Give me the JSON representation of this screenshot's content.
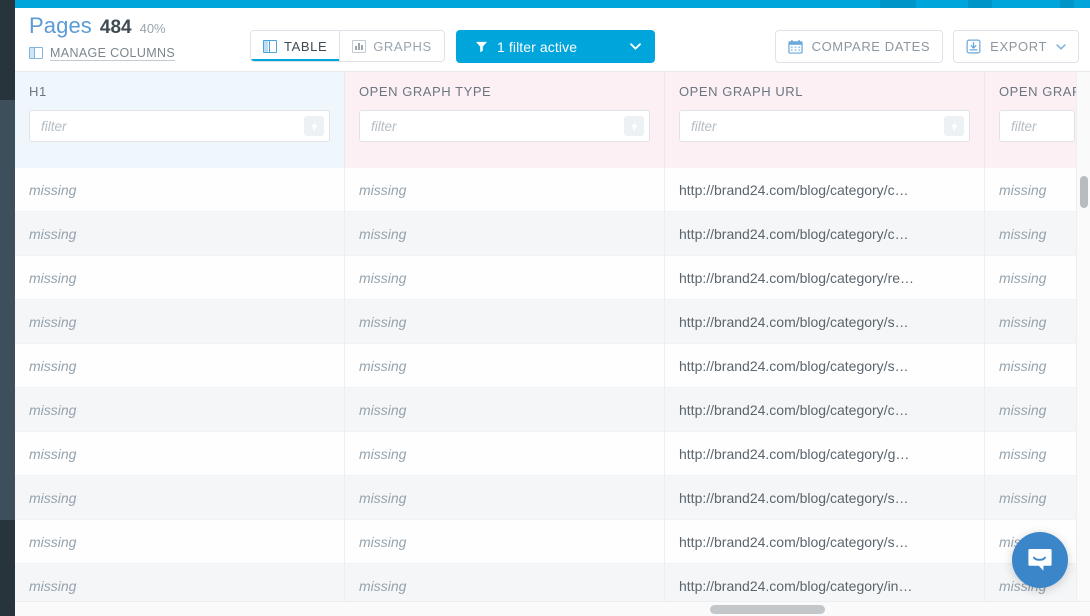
{
  "header": {
    "title": "Pages",
    "count": "484",
    "percent": "40%",
    "manage_columns_label": "MANAGE COLUMNS",
    "view_tabs": [
      {
        "label": "TABLE",
        "icon": "table-icon",
        "active": true
      },
      {
        "label": "GRAPHS",
        "icon": "bar-chart-icon",
        "active": false
      }
    ],
    "filter_button": {
      "label": "1 filter active",
      "icon": "funnel-icon",
      "chevron": "chevron-down-icon",
      "color": "#00a5db"
    },
    "compare_dates_label": "COMPARE DATES",
    "export_label": "EXPORT"
  },
  "table": {
    "columns": [
      {
        "label": "H1",
        "filter_placeholder": "filter",
        "filter_value": "",
        "tint": "#eff6fc"
      },
      {
        "label": "OPEN GRAPH TYPE",
        "filter_placeholder": "filter",
        "filter_value": "",
        "tint": "#fdf0f4"
      },
      {
        "label": "OPEN GRAPH URL",
        "filter_placeholder": "filter",
        "filter_value": "",
        "tint": "#fdf0f4"
      },
      {
        "label": "OPEN GRAPH T",
        "filter_placeholder": "filter",
        "filter_value": "",
        "tint": "#fdf0f4"
      }
    ],
    "rows": [
      {
        "h1": "missing",
        "og_type": "missing",
        "og_url": "http://brand24.com/blog/category/c…",
        "og_title": "missing"
      },
      {
        "h1": "missing",
        "og_type": "missing",
        "og_url": "http://brand24.com/blog/category/c…",
        "og_title": "missing"
      },
      {
        "h1": "missing",
        "og_type": "missing",
        "og_url": "http://brand24.com/blog/category/re…",
        "og_title": "missing"
      },
      {
        "h1": "missing",
        "og_type": "missing",
        "og_url": "http://brand24.com/blog/category/s…",
        "og_title": "missing"
      },
      {
        "h1": "missing",
        "og_type": "missing",
        "og_url": "http://brand24.com/blog/category/s…",
        "og_title": "missing"
      },
      {
        "h1": "missing",
        "og_type": "missing",
        "og_url": "http://brand24.com/blog/category/c…",
        "og_title": "missing"
      },
      {
        "h1": "missing",
        "og_type": "missing",
        "og_url": "http://brand24.com/blog/category/g…",
        "og_title": "missing"
      },
      {
        "h1": "missing",
        "og_type": "missing",
        "og_url": "http://brand24.com/blog/category/s…",
        "og_title": "missing"
      },
      {
        "h1": "missing",
        "og_type": "missing",
        "og_url": "http://brand24.com/blog/category/s…",
        "og_title": "missing"
      },
      {
        "h1": "missing",
        "og_type": "missing",
        "og_url": "http://brand24.com/blog/category/in…",
        "og_title": "missing"
      }
    ]
  },
  "widgets": {
    "intercom_label": "intercom-chat-icon"
  }
}
